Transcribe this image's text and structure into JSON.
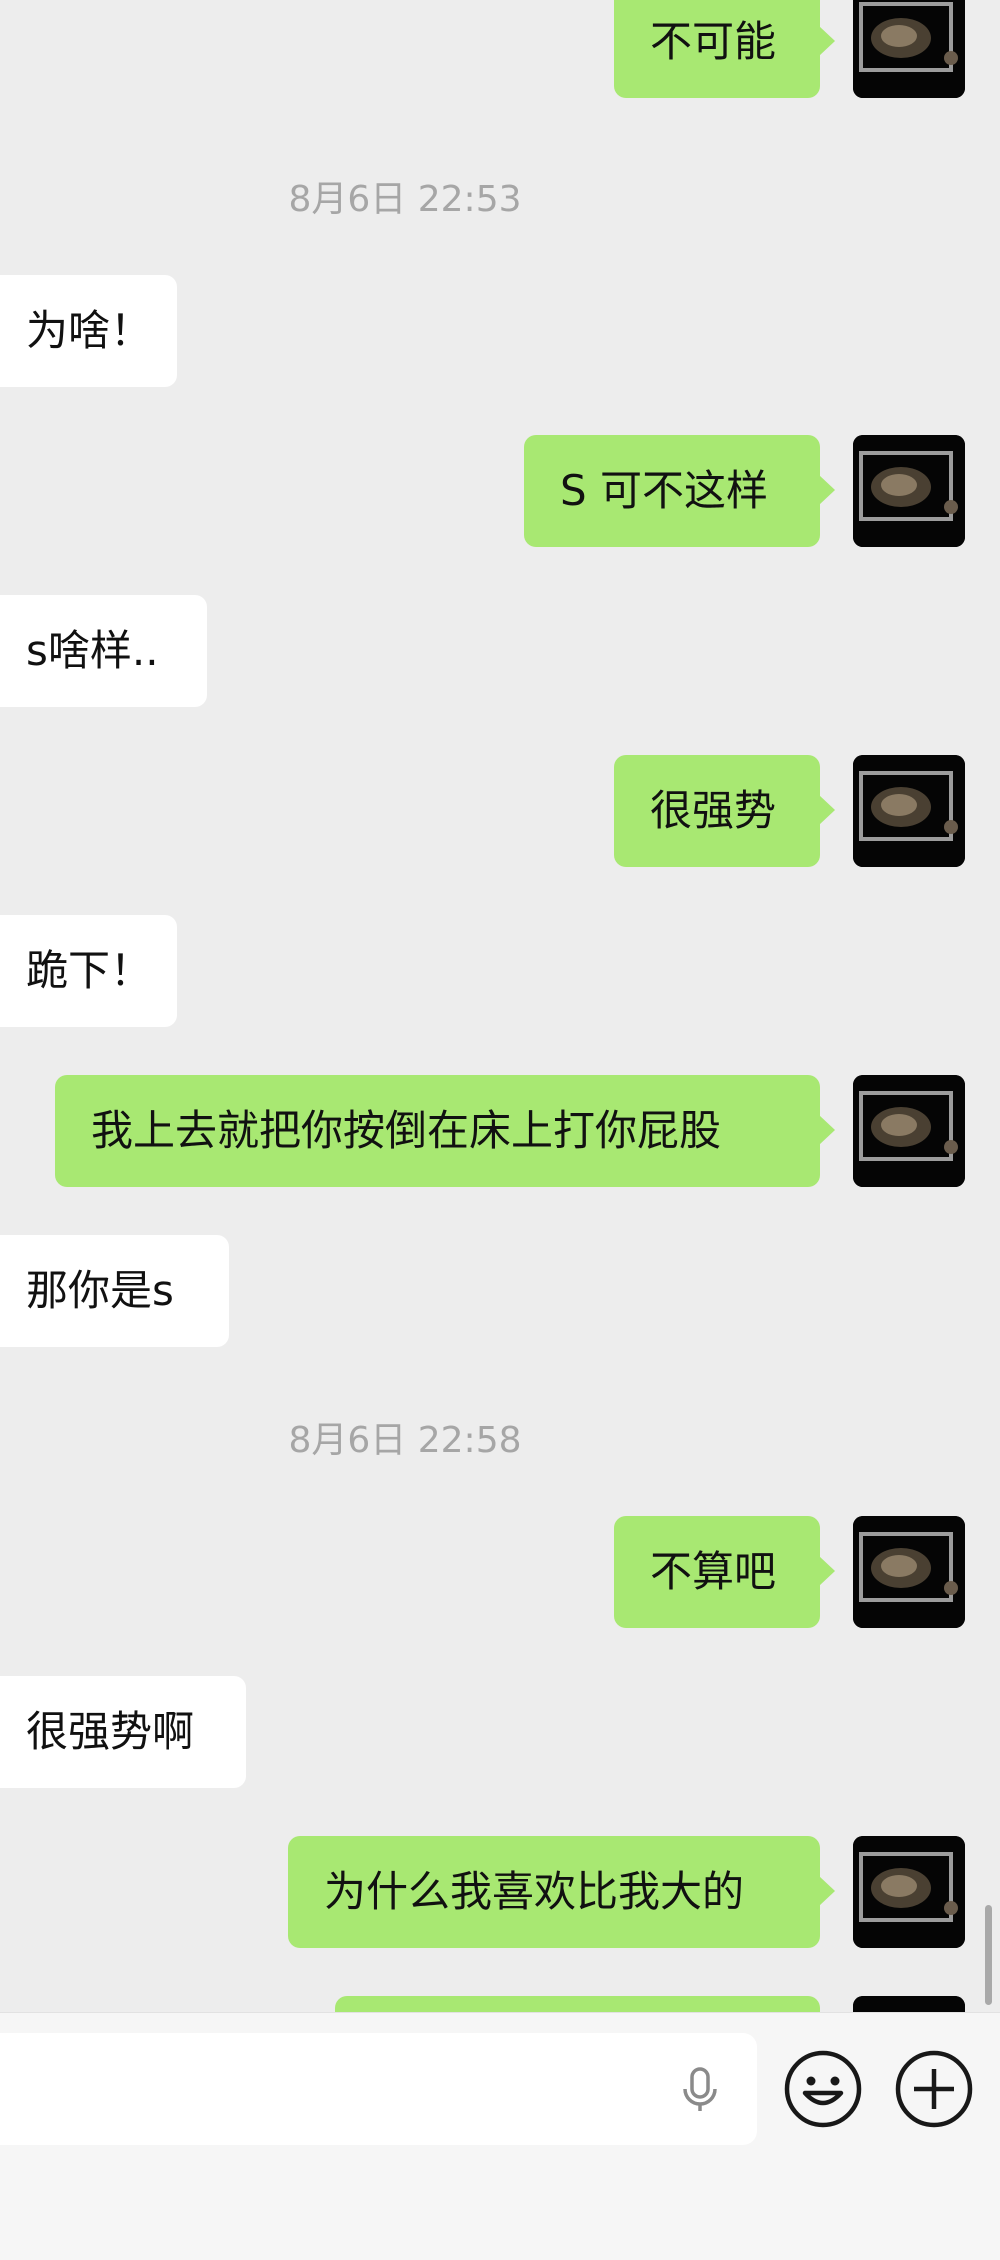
{
  "messages": [
    {
      "type": "out",
      "text": "不可能"
    },
    {
      "type": "time",
      "text": "8月6日 22:53"
    },
    {
      "type": "in",
      "text": "为啥！"
    },
    {
      "type": "out",
      "text": "S 可不这样"
    },
    {
      "type": "in",
      "text": "s啥样.."
    },
    {
      "type": "out",
      "text": "很强势"
    },
    {
      "type": "in",
      "text": "跪下！"
    },
    {
      "type": "out",
      "text": "我上去就把你按倒在床上打你屁股"
    },
    {
      "type": "in",
      "text": "那你是s"
    },
    {
      "type": "time",
      "text": "8月6日 22:58"
    },
    {
      "type": "out",
      "text": "不算吧"
    },
    {
      "type": "in",
      "text": "很强势啊"
    },
    {
      "type": "out",
      "text": "为什么我喜欢比我大的"
    },
    {
      "type": "out",
      "text": ""
    }
  ],
  "input_bar": {
    "voice_icon": "microphone-icon",
    "emoji_icon": "emoji-icon",
    "more_icon": "plus-icon"
  },
  "colors": {
    "background": "#ededed",
    "outgoing_bubble": "#a8e872",
    "incoming_bubble": "#ffffff",
    "timestamp": "#a6a6a6"
  }
}
